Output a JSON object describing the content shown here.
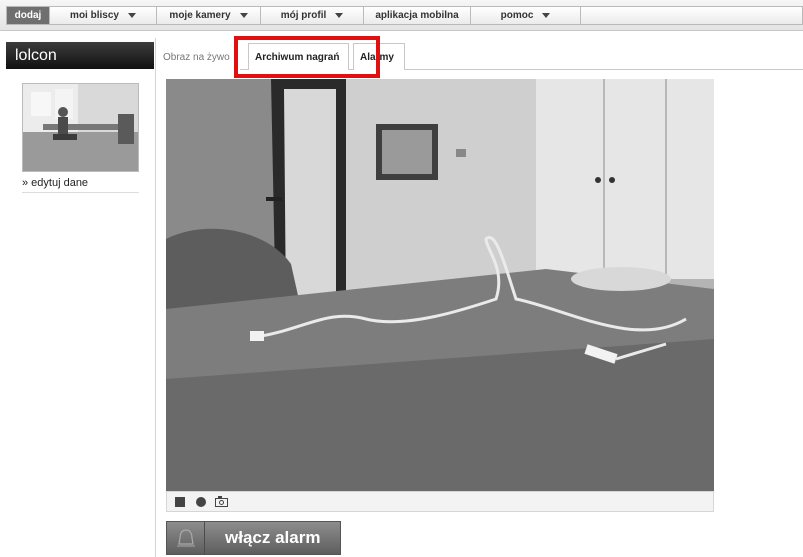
{
  "nav": {
    "items": [
      {
        "label": "dodaj",
        "dropdown": false,
        "active": true
      },
      {
        "label": "moi bliscy",
        "dropdown": true,
        "active": false
      },
      {
        "label": "moje kamery",
        "dropdown": true,
        "active": false
      },
      {
        "label": "mój profil",
        "dropdown": true,
        "active": false
      },
      {
        "label": "aplikacja mobilna",
        "dropdown": false,
        "active": false
      },
      {
        "label": "pomoc",
        "dropdown": true,
        "active": false
      }
    ]
  },
  "sidebar": {
    "title": "lolcon",
    "edit_link": "» edytuj dane"
  },
  "tabs": {
    "live": "Obraz na żywo",
    "archive": "Archiwum nagrań",
    "alarms": "Alarmy"
  },
  "video": {
    "controls": [
      "stop-icon",
      "record-icon",
      "snapshot-icon"
    ]
  },
  "alarm_button": {
    "label": "włącz alarm",
    "icon": "bell-icon"
  },
  "colors": {
    "highlight": "#e01010",
    "active_nav": "#6f6f6f"
  }
}
